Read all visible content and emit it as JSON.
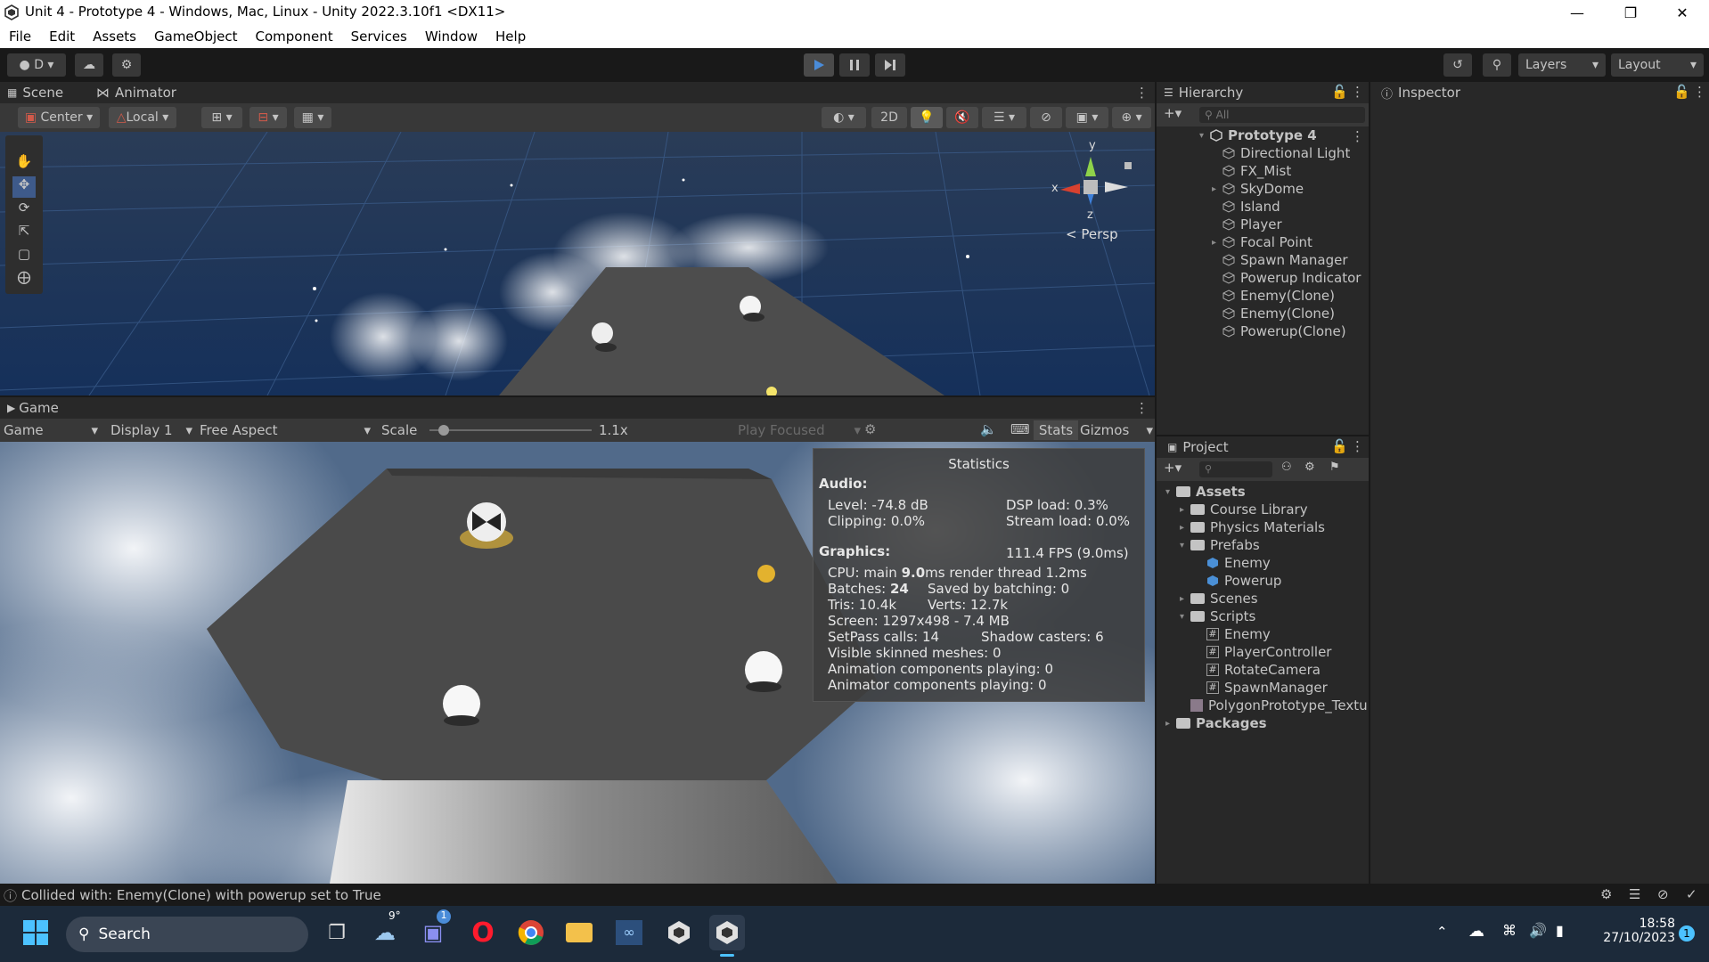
{
  "window": {
    "title": "Unit 4 - Prototype 4 - Windows, Mac, Linux - Unity 2022.3.10f1 <DX11>",
    "minimize": "—",
    "restore": "❐",
    "close": "✕"
  },
  "menu": [
    "File",
    "Edit",
    "Assets",
    "GameObject",
    "Component",
    "Services",
    "Window",
    "Help"
  ],
  "toolbar": {
    "account": "D",
    "layers": "Layers",
    "layout": "Layout"
  },
  "scene": {
    "tab_scene": "Scene",
    "tab_animator": "Animator",
    "center": "Center",
    "local": "Local",
    "mode_2d": "2D",
    "gizmo_y": "y",
    "gizmo_x": "x",
    "gizmo_z": "z",
    "persp": "Persp"
  },
  "game": {
    "tab": "Game",
    "game_dropdown": "Game",
    "display": "Display 1",
    "aspect": "Free Aspect",
    "scale_label": "Scale",
    "scale_value": "1.1x",
    "play_focused": "Play Focused",
    "stats": "Stats",
    "gizmos": "Gizmos"
  },
  "statistics": {
    "title": "Statistics",
    "audio_header": "Audio:",
    "level": "Level: -74.8 dB",
    "clipping": "Clipping: 0.0%",
    "dsp": "DSP load: 0.3%",
    "stream": "Stream load: 0.0%",
    "graphics_header": "Graphics:",
    "fps": "111.4 FPS (9.0ms)",
    "cpu_prefix": "CPU: main ",
    "cpu_main": "9.0",
    "cpu_suffix": "ms  render thread 1.2ms",
    "batches_prefix": "Batches: ",
    "batches": "24",
    "saved": "Saved by batching: 0",
    "tris": "Tris: 10.4k",
    "verts": "Verts: 12.7k",
    "screen": "Screen: 1297x498 - 7.4 MB",
    "setpass": "SetPass calls: 14",
    "shadow": "Shadow casters: 6",
    "skinned": "Visible skinned meshes: 0",
    "anim": "Animation components playing: 0",
    "animator": "Animator components playing: 0"
  },
  "hierarchy": {
    "tab": "Hierarchy",
    "search_placeholder": "All",
    "scene": "Prototype 4",
    "items": [
      "Directional Light",
      "FX_Mist",
      "SkyDome",
      "Island",
      "Player",
      "Focal Point",
      "Spawn Manager",
      "Powerup Indicator",
      "Enemy(Clone)",
      "Enemy(Clone)",
      "Powerup(Clone)"
    ]
  },
  "inspector": {
    "tab": "Inspector"
  },
  "project": {
    "tab": "Project",
    "assets": "Assets",
    "course_library": "Course Library",
    "physics_materials": "Physics Materials",
    "prefabs": "Prefabs",
    "prefab_items": [
      "Enemy",
      "Powerup"
    ],
    "scenes": "Scenes",
    "scripts": "Scripts",
    "script_items": [
      "Enemy",
      "PlayerController",
      "RotateCamera",
      "SpawnManager"
    ],
    "texture": "PolygonPrototype_Textu",
    "packages": "Packages"
  },
  "status": {
    "message": "Collided with: Enemy(Clone) with powerup set to True"
  },
  "taskbar": {
    "search": "Search",
    "weather_temp": "9°",
    "chat_badge": "1",
    "time": "18:58",
    "date": "27/10/2023",
    "notif_count": "1"
  },
  "colors": {
    "scene_sky": "#1e3a66",
    "game_sky": "#4a607f",
    "panel": "#282828",
    "dark": "#191919",
    "play_blue": "#4a8cd9"
  }
}
